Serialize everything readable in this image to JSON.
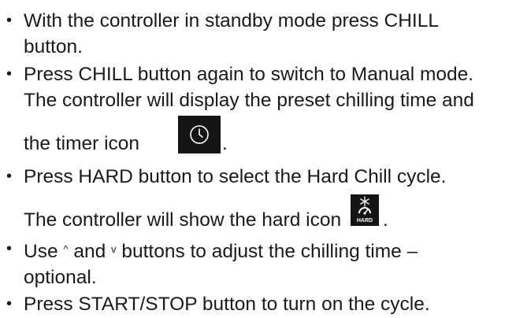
{
  "steps": [
    {
      "line1": "With the controller in standby mode press CHILL",
      "line2": "button."
    },
    {
      "line1": "Press CHILL button again to switch to Manual mode.",
      "line2": "The controller will display the preset chilling time and",
      "line3_text": "the timer icon",
      "line3_end": ".",
      "icon": "timer-icon"
    },
    {
      "line1": "Press HARD button to select the Hard Chill cycle.",
      "line2_text": "The controller will show the hard icon",
      "line2_end": ".",
      "icon": "hard-chill-icon",
      "icon_label": "HARD"
    },
    {
      "line1_pre": "Use",
      "up_symbol": "^",
      "line1_mid": "and",
      "down_symbol": "v",
      "line1_post": "buttons to adjust the chilling time –",
      "line2": "optional."
    },
    {
      "line1": "Press START/STOP button to turn on the cycle."
    }
  ],
  "bullet": "•",
  "colors": {
    "text": "#1a1a1a",
    "icon_bg": "#141414",
    "icon_fg": "#ffffff"
  }
}
